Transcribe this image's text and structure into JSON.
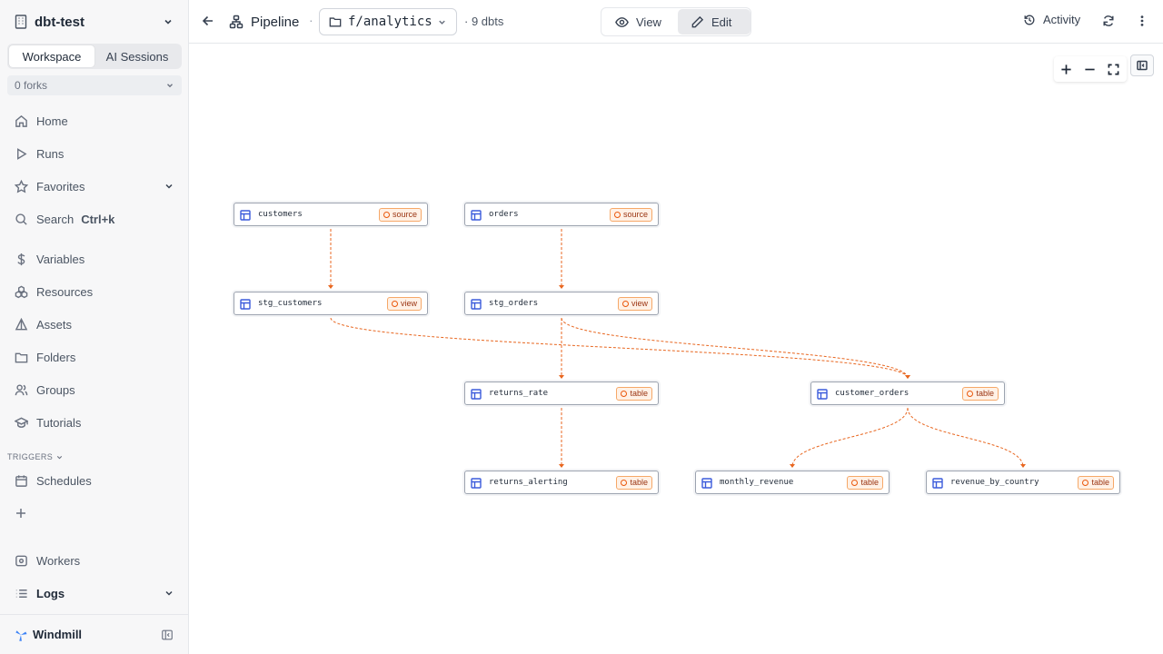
{
  "workspace": {
    "name": "dbt-test"
  },
  "sidebar": {
    "tabs": [
      "Workspace",
      "AI Sessions"
    ],
    "forks_label": "0 forks",
    "items": [
      {
        "label": "Home"
      },
      {
        "label": "Runs"
      },
      {
        "label": "Favorites"
      },
      {
        "label": "Search",
        "shortcut": "Ctrl+k"
      },
      {
        "label": "Variables"
      },
      {
        "label": "Resources"
      },
      {
        "label": "Assets"
      },
      {
        "label": "Folders"
      },
      {
        "label": "Groups"
      },
      {
        "label": "Tutorials"
      }
    ],
    "triggers_label": "TRIGGERS",
    "schedules_label": "Schedules",
    "workers_label": "Workers",
    "logs_label": "Logs",
    "brand": "Windmill"
  },
  "topbar": {
    "title": "Pipeline",
    "separator": "·",
    "path": "f/analytics",
    "count": "· 9 dbts",
    "view_label": "View",
    "edit_label": "Edit",
    "activity_label": "Activity"
  },
  "graph": {
    "nodes": [
      {
        "label": "customers",
        "badge": "source"
      },
      {
        "label": "orders",
        "badge": "source"
      },
      {
        "label": "stg_customers",
        "badge": "view"
      },
      {
        "label": "stg_orders",
        "badge": "view"
      },
      {
        "label": "returns_rate",
        "badge": "table"
      },
      {
        "label": "customer_orders",
        "badge": "table"
      },
      {
        "label": "returns_alerting",
        "badge": "table"
      },
      {
        "label": "monthly_revenue",
        "badge": "table"
      },
      {
        "label": "revenue_by_country",
        "badge": "table"
      }
    ],
    "edges": [
      [
        "customers",
        "stg_customers"
      ],
      [
        "orders",
        "stg_orders"
      ],
      [
        "stg_orders",
        "returns_rate"
      ],
      [
        "stg_customers",
        "customer_orders"
      ],
      [
        "stg_orders",
        "customer_orders"
      ],
      [
        "returns_rate",
        "returns_alerting"
      ],
      [
        "customer_orders",
        "monthly_revenue"
      ],
      [
        "customer_orders",
        "revenue_by_country"
      ]
    ],
    "edge_color": "#e8661f"
  }
}
